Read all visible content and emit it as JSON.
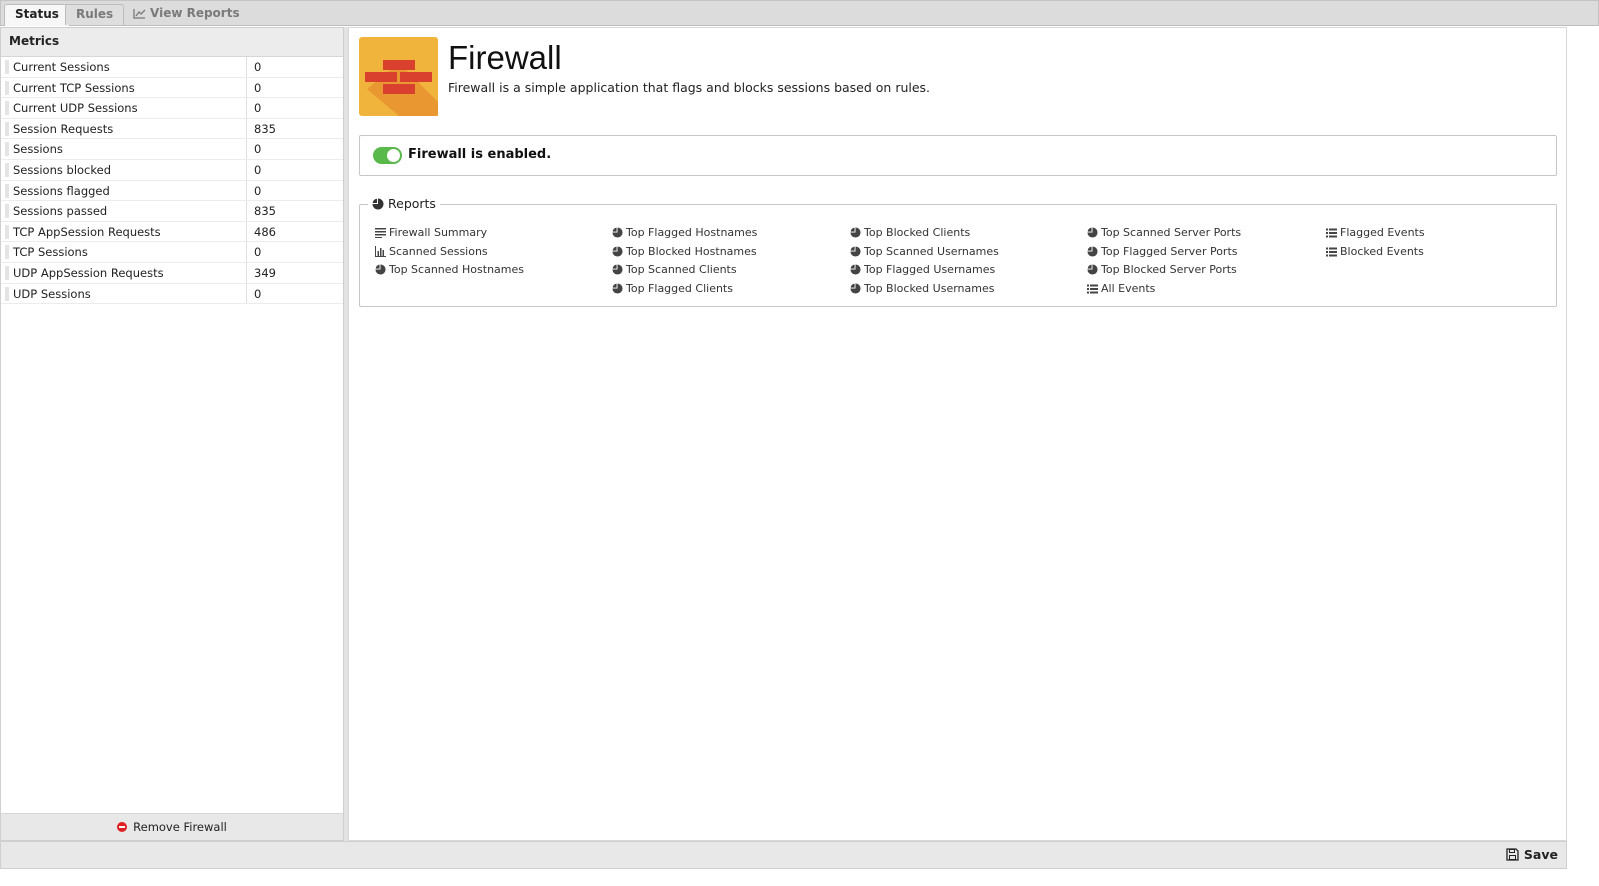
{
  "tabs": [
    {
      "label": "Status"
    },
    {
      "label": "Rules"
    },
    {
      "label": "View Reports",
      "icon": "line-chart-icon"
    }
  ],
  "metrics": {
    "title": "Metrics",
    "rows": [
      {
        "name": "Current Sessions",
        "value": "0"
      },
      {
        "name": "Current TCP Sessions",
        "value": "0"
      },
      {
        "name": "Current UDP Sessions",
        "value": "0"
      },
      {
        "name": "Session Requests",
        "value": "835"
      },
      {
        "name": "Sessions",
        "value": "0"
      },
      {
        "name": "Sessions blocked",
        "value": "0"
      },
      {
        "name": "Sessions flagged",
        "value": "0"
      },
      {
        "name": "Sessions passed",
        "value": "835"
      },
      {
        "name": "TCP AppSession Requests",
        "value": "486"
      },
      {
        "name": "TCP Sessions",
        "value": "0"
      },
      {
        "name": "UDP AppSession Requests",
        "value": "349"
      },
      {
        "name": "UDP Sessions",
        "value": "0"
      }
    ],
    "remove_label": "Remove Firewall"
  },
  "app": {
    "title": "Firewall",
    "description": "Firewall is a simple application that flags and blocks sessions based on rules.",
    "icon": "firewall-brick-icon",
    "enabled_text": "Firewall is enabled."
  },
  "reports": {
    "legend": "Reports",
    "columns": [
      [
        {
          "label": "Firewall Summary",
          "icon": "text-icon"
        },
        {
          "label": "Scanned Sessions",
          "icon": "bar-chart-icon"
        },
        {
          "label": "Top Scanned Hostnames",
          "icon": "pie-chart-icon"
        }
      ],
      [
        {
          "label": "Top Flagged Hostnames",
          "icon": "pie-chart-icon"
        },
        {
          "label": "Top Blocked Hostnames",
          "icon": "pie-chart-icon"
        },
        {
          "label": "Top Scanned Clients",
          "icon": "pie-chart-icon"
        },
        {
          "label": "Top Flagged Clients",
          "icon": "pie-chart-icon"
        }
      ],
      [
        {
          "label": "Top Blocked Clients",
          "icon": "pie-chart-icon"
        },
        {
          "label": "Top Scanned Usernames",
          "icon": "pie-chart-icon"
        },
        {
          "label": "Top Flagged Usernames",
          "icon": "pie-chart-icon"
        },
        {
          "label": "Top Blocked Usernames",
          "icon": "pie-chart-icon"
        }
      ],
      [
        {
          "label": "Top Scanned Server Ports",
          "icon": "pie-chart-icon"
        },
        {
          "label": "Top Flagged Server Ports",
          "icon": "pie-chart-icon"
        },
        {
          "label": "Top Blocked Server Ports",
          "icon": "pie-chart-icon"
        },
        {
          "label": "All Events",
          "icon": "list-icon"
        }
      ],
      [
        {
          "label": "Flagged Events",
          "icon": "list-icon"
        },
        {
          "label": "Blocked Events",
          "icon": "list-icon"
        }
      ]
    ]
  },
  "footer": {
    "save_label": "Save"
  },
  "colors": {
    "toggle_on": "#59b94b",
    "icon_bg": "#f0b43c",
    "brick": "#d9402e"
  }
}
